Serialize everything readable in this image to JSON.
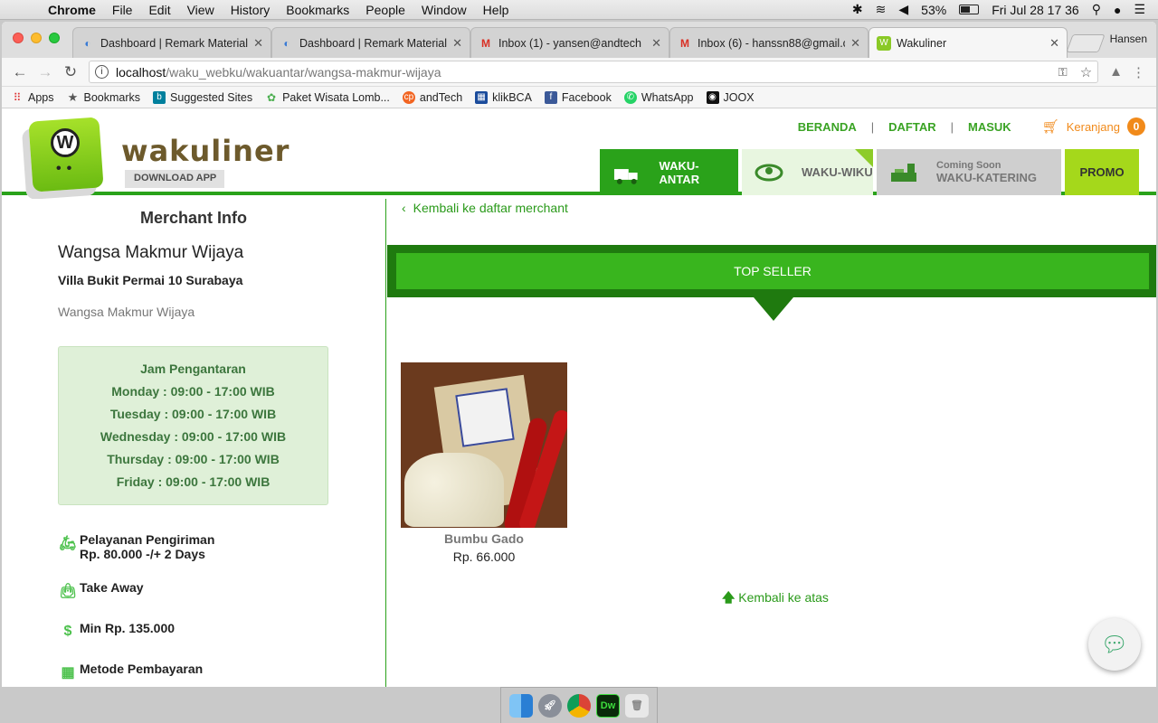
{
  "menubar": {
    "app": "Chrome",
    "items": [
      "File",
      "Edit",
      "View",
      "History",
      "Bookmarks",
      "People",
      "Window",
      "Help"
    ],
    "battery": "53%",
    "clock": "Fri Jul 28  17 36"
  },
  "tabs": [
    {
      "title": "Dashboard | Remark Material",
      "icon": "spinner-icon"
    },
    {
      "title": "Dashboard | Remark Material",
      "icon": "spinner-icon"
    },
    {
      "title": "Inbox (1) - yansen@andtech",
      "icon": "gmail-icon"
    },
    {
      "title": "Inbox (6) - hanssn88@gmail.c",
      "icon": "gmail-icon"
    },
    {
      "title": "Wakuliner",
      "icon": "wakuliner-icon"
    }
  ],
  "profile": "Hansen",
  "address": {
    "domain": "localhost",
    "path": "/waku_webku/wakuantar/wangsa-makmur-wijaya"
  },
  "bookmarks": [
    "Apps",
    "Bookmarks",
    "Suggested Sites",
    "Paket Wisata Lomb...",
    "andTech",
    "klikBCA",
    "Facebook",
    "WhatsApp",
    "JOOX"
  ],
  "site": {
    "logo_text": "wakuliner",
    "download_app": "DOWNLOAD APP",
    "nav": {
      "home": "BERANDA",
      "register": "DAFTAR",
      "login": "MASUK",
      "cart": "Keranjang",
      "cart_count": "0"
    },
    "services": {
      "antar": "WAKU-ANTAR",
      "wiku": "WAKU-WIKU",
      "katering_soon": "Coming Soon",
      "katering": "WAKU-KATERING",
      "promo": "PROMO"
    }
  },
  "merchant": {
    "heading": "Merchant Info",
    "name": "Wangsa Makmur Wijaya",
    "address": "Villa Bukit Permai 10 Surabaya",
    "description": "Wangsa Makmur Wijaya",
    "hours_title": "Jam Pengantaran",
    "hours": [
      "Monday : 09:00 - 17:00 WIB",
      "Tuesday : 09:00 - 17:00 WIB",
      "Wednesday : 09:00 - 17:00 WIB",
      "Thursday : 09:00 - 17:00 WIB",
      "Friday : 09:00 - 17:00 WIB"
    ],
    "shipping_label": "Pelayanan Pengiriman",
    "shipping_value": "Rp. 80.000 -/+ 2 Days",
    "takeaway": "Take Away",
    "minimum": "Min Rp. 135.000",
    "payment": "Metode Pembayaran"
  },
  "content": {
    "back_link": "Kembali ke daftar merchant",
    "section_title": "TOP SELLER",
    "product": {
      "name": "Bumbu Gado",
      "price": "Rp. 66.000"
    },
    "back_to_top": "Kembali ke atas"
  },
  "colors": {
    "brand_green": "#2aa21a",
    "accent_orange": "#f18a1a"
  }
}
